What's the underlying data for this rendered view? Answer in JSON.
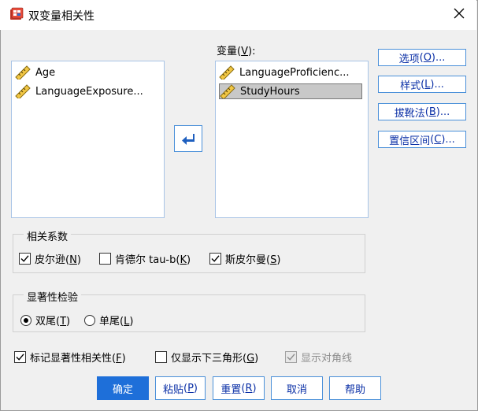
{
  "window": {
    "title": "双变量相关性"
  },
  "source_list": {
    "items": [
      "Age",
      "LanguageExposure..."
    ]
  },
  "variables": {
    "label": "变量",
    "mnemonic": "V",
    "label_suffix": ":",
    "items": [
      "LanguageProficienc...",
      "StudyHours"
    ],
    "selected_index": 1
  },
  "side_buttons": [
    {
      "label": "选项",
      "mnemonic": "O",
      "suffix": "..."
    },
    {
      "label": "样式",
      "mnemonic": "L",
      "suffix": "..."
    },
    {
      "label": "拔靴法",
      "mnemonic": "B",
      "suffix": "..."
    },
    {
      "label": "置信区间",
      "mnemonic": "C",
      "suffix": "..."
    }
  ],
  "correlation": {
    "title": "相关系数",
    "options": [
      {
        "label": "皮尔逊",
        "mnemonic": "N",
        "checked": true
      },
      {
        "label": "肯德尔 tau-b",
        "mnemonic": "K",
        "checked": false
      },
      {
        "label": "斯皮尔曼",
        "mnemonic": "S",
        "checked": true
      }
    ]
  },
  "significance": {
    "title": "显著性检验",
    "options": [
      {
        "label": "双尾",
        "mnemonic": "T",
        "selected": true
      },
      {
        "label": "单尾",
        "mnemonic": "L",
        "selected": false
      }
    ]
  },
  "flags": [
    {
      "label": "标记显著性相关性",
      "mnemonic": "F",
      "checked": true,
      "disabled": false
    },
    {
      "label": "仅显示下三角形",
      "mnemonic": "G",
      "checked": false,
      "disabled": false
    },
    {
      "label": "显示对角线",
      "mnemonic": "",
      "checked": true,
      "disabled": true
    }
  ],
  "buttons": [
    {
      "label": "确定",
      "mnemonic": ""
    },
    {
      "label": "粘贴",
      "mnemonic": "P"
    },
    {
      "label": "重置",
      "mnemonic": "R"
    },
    {
      "label": "取消",
      "mnemonic": ""
    },
    {
      "label": "帮助",
      "mnemonic": ""
    }
  ],
  "icons": {
    "app": "spss-dialog-icon",
    "close": "close-icon",
    "variable": "ruler-scale-icon",
    "move": "arrow-left-icon"
  },
  "colors": {
    "accent": "#1e6fd9",
    "list_border": "#a8c4e6",
    "link_text": "#0a2fa6",
    "selected_item": "#c8c8c8"
  }
}
